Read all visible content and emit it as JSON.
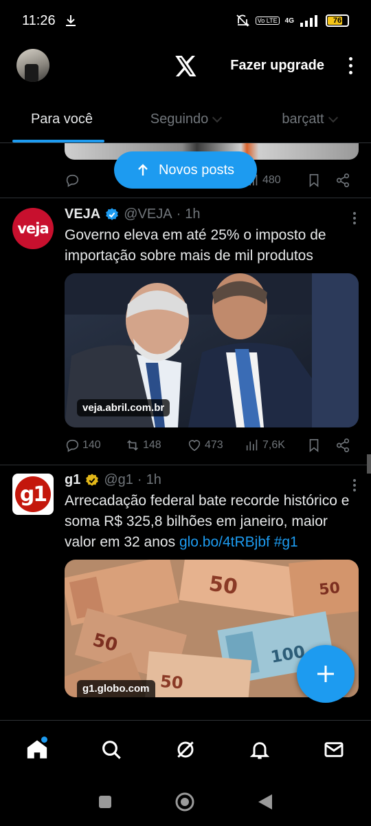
{
  "status_bar": {
    "time": "11:26",
    "network": "4G",
    "volte": "Vo LTE",
    "battery": "76",
    "battery_level": 0.76
  },
  "top_bar": {
    "upgrade_label": "Fazer upgrade"
  },
  "tabs": [
    {
      "label": "Para você",
      "active": true
    },
    {
      "label": "Seguindo",
      "active": false
    },
    {
      "label": "barçatt",
      "active": false
    }
  ],
  "new_posts": {
    "label": "Novos posts"
  },
  "partial_post": {
    "views": "480"
  },
  "posts": [
    {
      "name": "VEJA",
      "verified_color": "#1d9bf0",
      "handle": "@VEJA",
      "time": "1h",
      "avatar_text": "veja",
      "avatar_color": "#c8102e",
      "text": "Governo eleva em até 25% o imposto de importação sobre mais de mil produtos",
      "media_label": "veja.abril.com.br",
      "replies": "140",
      "reposts": "148",
      "likes": "473",
      "views": "7,6K"
    },
    {
      "name": "g1",
      "verified_color": "#e2b719",
      "handle": "@g1",
      "time": "1h",
      "avatar_text": "g1",
      "avatar_color": "#c4170c",
      "text": "Arrecadação federal bate recorde histórico e soma R$ 325,8 bilhões em janeiro, maior valor em 32 anos",
      "link_text": "glo.bo/4tRBjbf",
      "hashtag": "#g1",
      "media_label": "g1.globo.com"
    }
  ],
  "colors": {
    "accent": "#1d9bf0",
    "muted": "#71767b",
    "background": "#000000"
  },
  "icons": [
    "download-icon",
    "mute-icon",
    "signal-icon",
    "x-logo-icon",
    "home-icon",
    "search-icon",
    "grok-icon",
    "bell-icon",
    "mail-icon",
    "compose-plus-icon",
    "reply-icon",
    "repost-icon",
    "like-icon",
    "views-icon",
    "bookmark-icon",
    "share-icon"
  ]
}
